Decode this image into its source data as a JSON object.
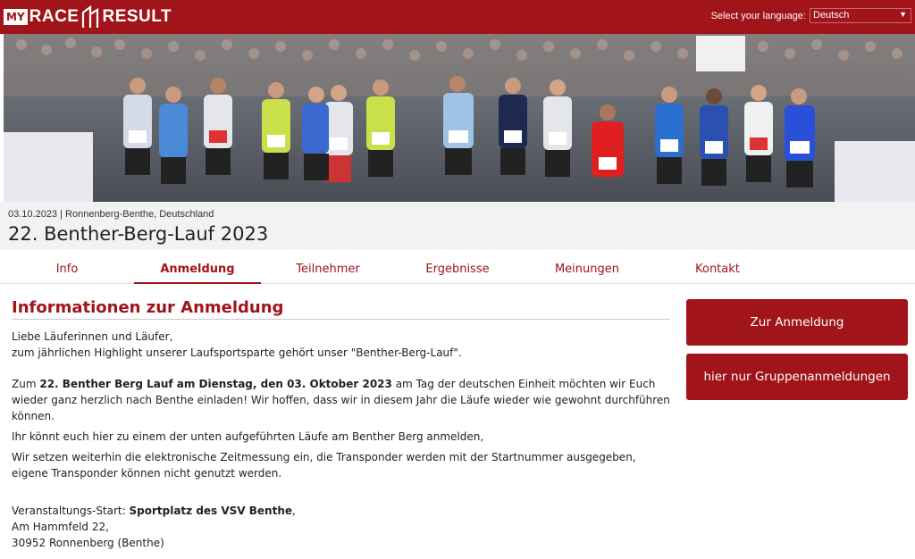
{
  "header": {
    "logo": {
      "my": "MY",
      "race": "RACE",
      "result": "RESULT"
    },
    "language_label": "Select your language:",
    "language_value": "Deutsch"
  },
  "event": {
    "meta": "03.10.2023 | Ronnenberg-Benthe, Deutschland",
    "title": "22. Benther-Berg-Lauf 2023"
  },
  "tabs": [
    {
      "label": "Info"
    },
    {
      "label": "Anmeldung",
      "active": true
    },
    {
      "label": "Teilnehmer"
    },
    {
      "label": "Ergebnisse"
    },
    {
      "label": "Meinungen"
    },
    {
      "label": "Kontakt"
    }
  ],
  "content": {
    "title": "Informationen zur Anmeldung",
    "greeting_1": "Liebe Läuferinnen und Läufer,",
    "greeting_2": "zum jährlichen Highlight unserer Laufsportsparte gehört unser \"Benther-Berg-Lauf\".",
    "p2_pre": "Zum ",
    "p2_bold": "22. Benther Berg Lauf am Dienstag, den 03. Oktober 2023",
    "p2_post": " am Tag der deutschen Einheit möchten wir Euch wieder ganz herzlich nach Benthe einladen! Wir hoffen, dass wir in diesem Jahr die Läufe wieder wie gewohnt durchführen können.",
    "p3": "Ihr könnt euch hier zu einem der unten aufgeführten Läufe am Benther Berg anmelden,",
    "p4": "Wir setzen weiterhin die elektronische Zeitmessung ein, die Transponder werden mit der Startnummer ausgegeben, eigene Transponder können nicht genutzt werden.",
    "venue_pre": "Veranstaltungs-Start: ",
    "venue_bold": "Sportplatz des VSV Benthe",
    "venue_post": ",",
    "address_1": "Am Hammfeld 22,",
    "address_2": "30952 Ronnenberg (Benthe)"
  },
  "buttons": {
    "register": "Zur Anmeldung",
    "group": "hier nur Gruppenanmeldungen"
  },
  "colors": {
    "brand": "#a0141a",
    "header_bg": "#f2f2f2"
  }
}
